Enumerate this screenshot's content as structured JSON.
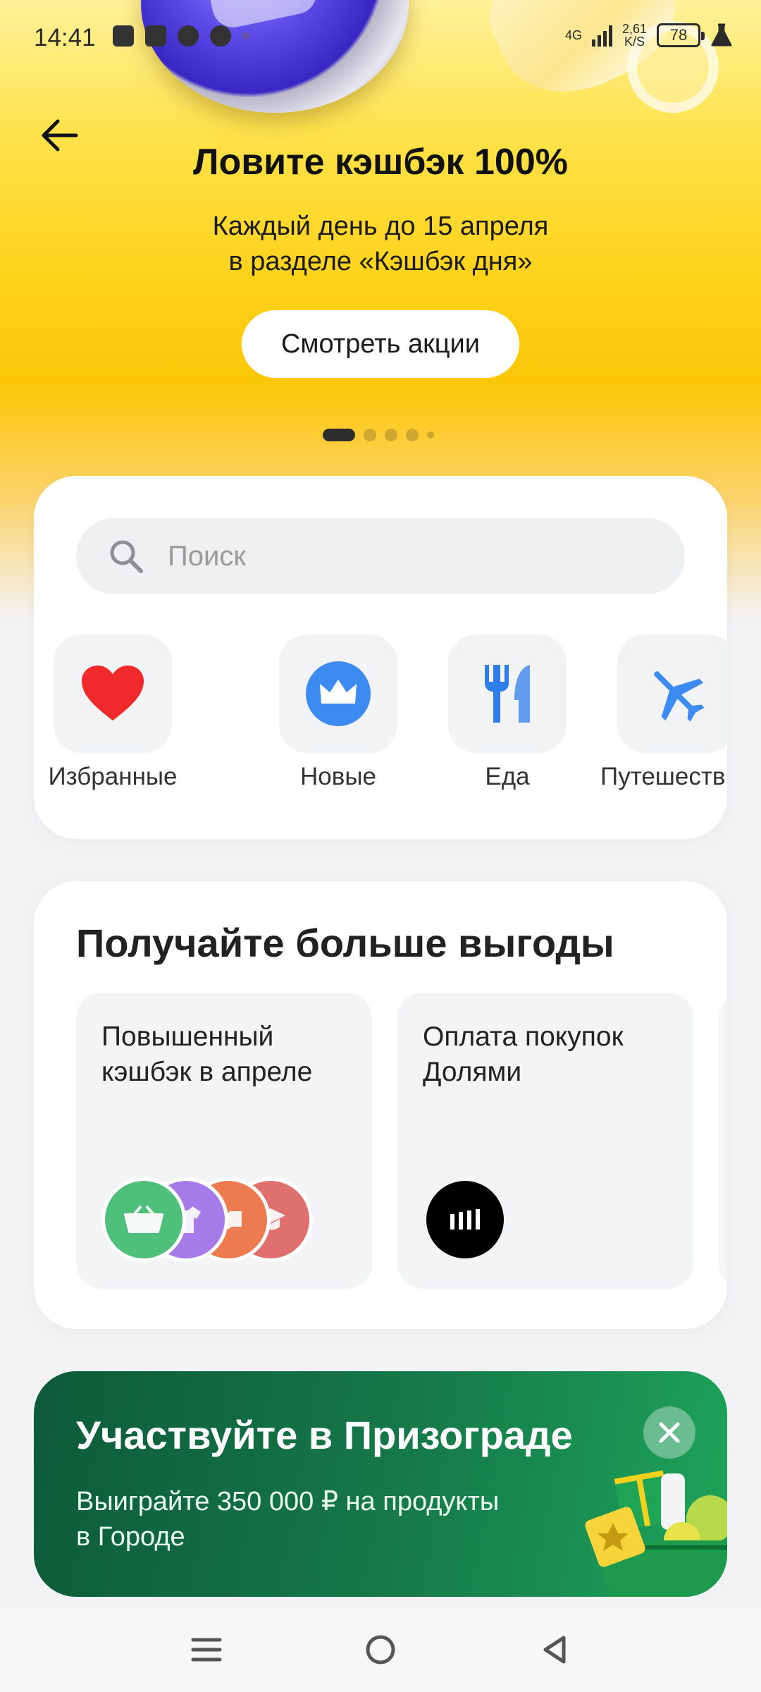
{
  "status_bar": {
    "time": "14:41",
    "network": "4G",
    "speed_value": "2,61",
    "speed_unit": "K/S",
    "battery": "78"
  },
  "hero": {
    "title": "Ловите кэшбэк 100%",
    "subtitle_line1": "Каждый день до 15 апреля",
    "subtitle_line2": "в разделе «Кэшбэк дня»",
    "button_label": "Смотреть акции",
    "carousel_total": 5,
    "carousel_active": 1
  },
  "search": {
    "placeholder": "Поиск"
  },
  "categories": [
    {
      "label": "Избранные",
      "icon": "heart-icon"
    },
    {
      "label": "Новые",
      "icon": "crown-icon"
    },
    {
      "label": "Еда",
      "icon": "fork-knife-icon"
    },
    {
      "label": "Путешествия",
      "icon": "airplane-icon"
    }
  ],
  "benefits": {
    "title": "Получайте больше выгоды",
    "tiles": [
      {
        "title_line1": "Повышенный",
        "title_line2": "кэшбэк в апреле"
      },
      {
        "title_line1": "Оплата покупок",
        "title_line2": "Долями"
      }
    ]
  },
  "prize": {
    "title": "Участвуйте в Призограде",
    "subtitle_line1": "Выиграйте 350 000 ₽ на продукты",
    "subtitle_line2": "в Городе"
  },
  "colors": {
    "hero_yellow": "#fdd21a",
    "search_bg": "#eff0f2",
    "tile_bg": "#f2f3f5",
    "heart_red": "#f02a2a",
    "accent_blue": "#3d8bf0",
    "prize_green": "#167a4a"
  }
}
